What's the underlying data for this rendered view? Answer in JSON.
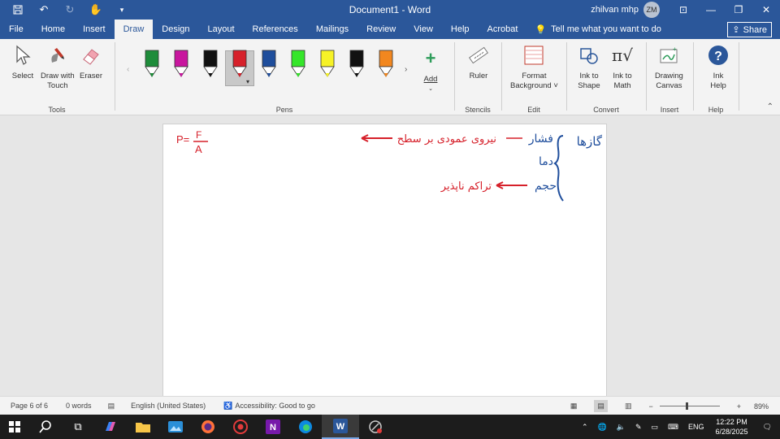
{
  "titlebar": {
    "doc_title": "Document1 - Word",
    "user_name": "zhilvan mhp",
    "user_initials": "ZM"
  },
  "tabs": [
    "File",
    "Home",
    "Insert",
    "Draw",
    "Design",
    "Layout",
    "References",
    "Mailings",
    "Review",
    "View",
    "Help",
    "Acrobat"
  ],
  "active_tab": "Draw",
  "tell_me": "Tell me what you want to do",
  "share_label": "Share",
  "ribbon": {
    "tools": {
      "select_label": "Select",
      "draw_touch_label1": "Draw with",
      "draw_touch_label2": "Touch",
      "eraser_label": "Eraser",
      "group_label": "Tools"
    },
    "pens": {
      "group_label": "Pens",
      "add_label": "Add",
      "colors": [
        "#1e8c3a",
        "#c8169e",
        "#111111",
        "#d6202a",
        "#1f4e9c",
        "#35e62a",
        "#f6f227",
        "#111111",
        "#f2871f"
      ]
    },
    "stencils": {
      "ruler_label": "Ruler",
      "group_label": "Stencils"
    },
    "edit": {
      "format_bg_label1": "Format",
      "format_bg_label2": "Background",
      "group_label": "Edit"
    },
    "convert": {
      "ink_shape_label1": "Ink to",
      "ink_shape_label2": "Shape",
      "ink_math_label1": "Ink to",
      "ink_math_label2": "Math",
      "group_label": "Convert"
    },
    "insert": {
      "drawing_canvas_label1": "Drawing",
      "drawing_canvas_label2": "Canvas",
      "group_label": "Insert"
    },
    "help": {
      "ink_help_label1": "Ink",
      "ink_help_label2": "Help",
      "group_label": "Help"
    }
  },
  "document": {
    "formula_p": "P=",
    "formula_num": "F",
    "formula_den": "A",
    "heading_gases": "گازها",
    "pressure": "فشار",
    "pressure_def": "نیروی عمودی بر سطح",
    "temperature": "دما",
    "volume": "حجم",
    "volume_def": "تراکم ناپذیر",
    "ink_blue": "#1f4e9c",
    "ink_red": "#d6202a"
  },
  "status": {
    "page": "Page 6 of 6",
    "words": "0 words",
    "language": "English (United States)",
    "accessibility": "Accessibility: Good to go",
    "zoom": "89%",
    "zoom_fraction": 0.45
  },
  "taskbar": {
    "lang": "ENG",
    "time": "12:22 PM",
    "date": "6/28/2025"
  }
}
